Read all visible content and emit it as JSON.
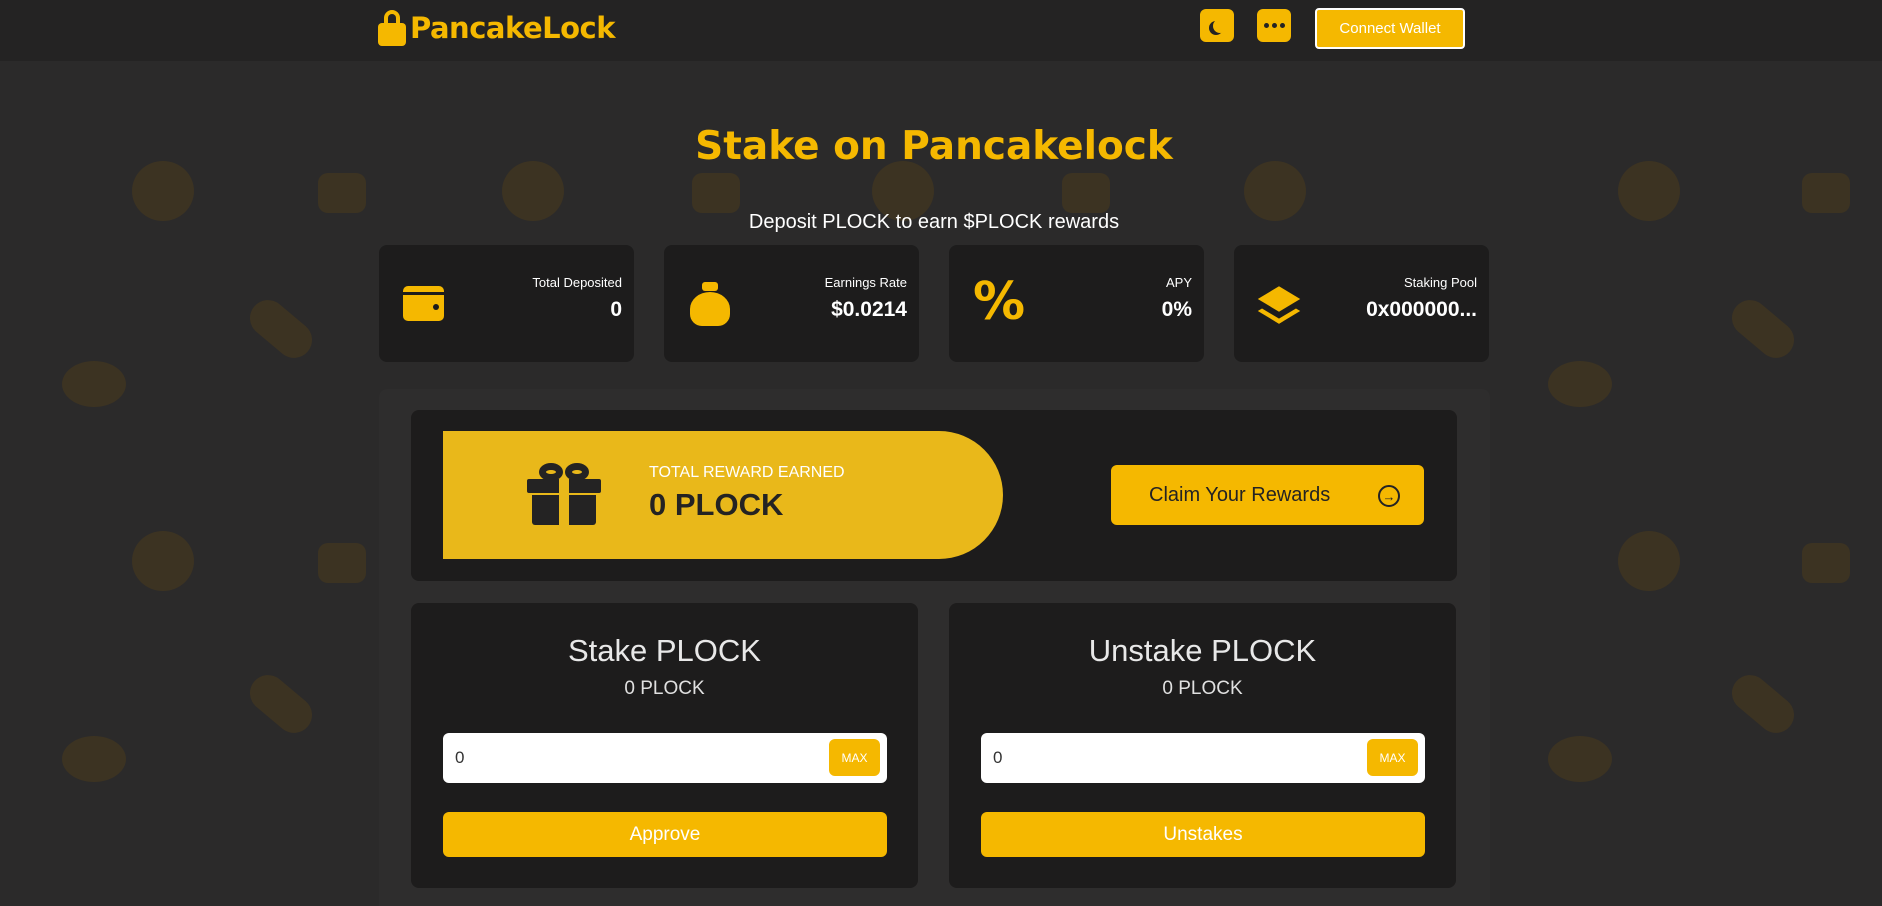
{
  "app": {
    "logo_text": "PancakeLock"
  },
  "nav": {
    "theme_icon": "moon-icon",
    "more_icon": "more-dots-icon",
    "connect_label": "Connect Wallet"
  },
  "hero": {
    "title": "Stake on Pancakelock",
    "subtitle": "Deposit PLOCK to earn $PLOCK rewards"
  },
  "stats": [
    {
      "icon": "wallet-icon",
      "label": "Total Deposited",
      "value": "0"
    },
    {
      "icon": "money-bag-icon",
      "label": "Earnings Rate",
      "value": "$0.0214"
    },
    {
      "icon": "percent-icon",
      "label": "APY",
      "value": "0%"
    },
    {
      "icon": "layers-icon",
      "label": "Staking Pool",
      "value": "0x000000..."
    }
  ],
  "reward": {
    "icon": "gift-icon",
    "label": "TOTAL REWARD EARNED",
    "value": "0 PLOCK",
    "claim_label": "Claim Your Rewards",
    "claim_icon": "arrow-right-circle-icon"
  },
  "stake": {
    "title": "Stake PLOCK",
    "balance": "0 PLOCK",
    "input_value": "0",
    "max_label": "MAX",
    "button_label": "Approve"
  },
  "unstake": {
    "title": "Unstake PLOCK",
    "balance": "0 PLOCK",
    "input_value": "0",
    "max_label": "MAX",
    "button_label": "Unstakes"
  },
  "colors": {
    "accent": "#f5b800",
    "background": "#2b2a2a",
    "card": "#1d1c1c",
    "navbar": "#242323"
  }
}
